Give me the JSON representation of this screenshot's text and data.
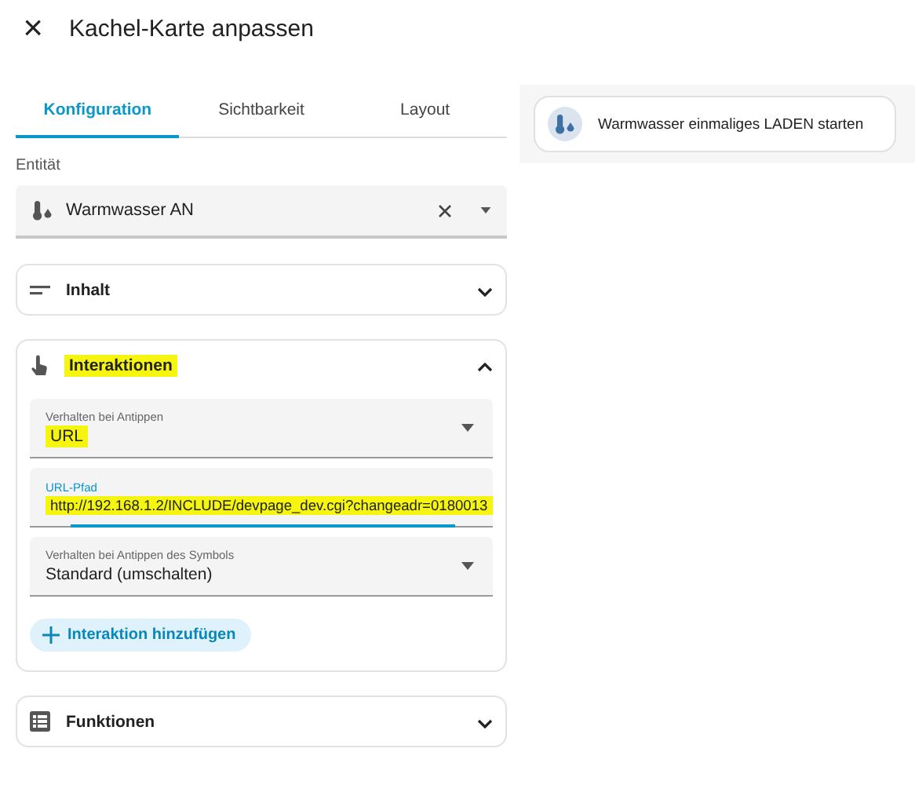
{
  "dialog": {
    "title": "Kachel-Karte anpassen",
    "close_label": "×"
  },
  "tabs": [
    {
      "label": "Konfiguration",
      "selected": true
    },
    {
      "label": "Sichtbarkeit",
      "selected": false
    },
    {
      "label": "Layout",
      "selected": false
    }
  ],
  "entity": {
    "label": "Entität",
    "value": "Warmwasser AN"
  },
  "sections": [
    {
      "kind": "content",
      "title": "Inhalt",
      "expanded": false,
      "highlighted": false
    },
    {
      "kind": "interactions",
      "title": "Interaktionen",
      "expanded": true,
      "highlighted": true,
      "fields": [
        {
          "kind": "select",
          "label": "Verhalten bei Antippen",
          "value": "URL",
          "highlighted": true,
          "focused": false
        },
        {
          "kind": "text",
          "label": "URL-Pfad",
          "value": "http://192.168.1.2/INCLUDE/devpage_dev.cgi?changeadr=0180013",
          "highlighted": true,
          "focused": true
        },
        {
          "kind": "select",
          "label": "Verhalten bei Antippen des Symbols",
          "value": "Standard (umschalten)",
          "highlighted": false,
          "focused": false
        }
      ],
      "add_button": "Interaktion hinzufügen"
    },
    {
      "kind": "features",
      "title": "Funktionen",
      "expanded": false,
      "highlighted": false
    }
  ],
  "preview": {
    "tile_name": "Warmwasser einmaliges LADEN starten"
  }
}
